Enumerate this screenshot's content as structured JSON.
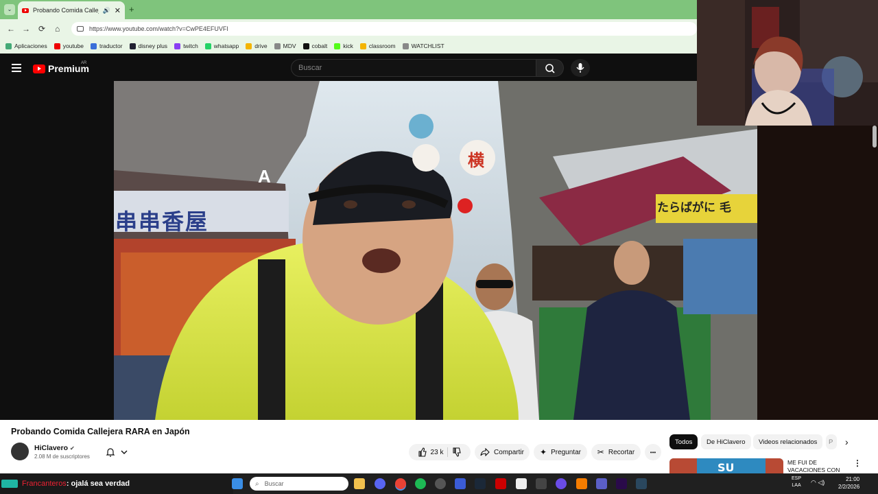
{
  "browser": {
    "tab_title": "Probando Comida Callejera",
    "tab_close": "✕",
    "new_tab": "+",
    "url": "https://www.youtube.com/watch?v=CwPE4EFUVFI",
    "nav": {
      "back": "←",
      "forward": "→",
      "reload": "⟳",
      "home": "⌂"
    },
    "bookmarks": [
      {
        "label": "Aplicaciones",
        "color": "#4a7"
      },
      {
        "label": "youtube",
        "color": "#e00"
      },
      {
        "label": "traductor",
        "color": "#3b6fd9"
      },
      {
        "label": "disney plus",
        "color": "#223"
      },
      {
        "label": "twitch",
        "color": "#8a3ff3"
      },
      {
        "label": "whatsapp",
        "color": "#25d366"
      },
      {
        "label": "drive",
        "color": "#f4b400"
      },
      {
        "label": "MDV",
        "color": "#888"
      },
      {
        "label": "cobalt",
        "color": "#111"
      },
      {
        "label": "kick",
        "color": "#53fc18"
      },
      {
        "label": "classroom",
        "color": "#f4b400"
      },
      {
        "label": "WATCHLIST",
        "color": "#888"
      }
    ]
  },
  "youtube": {
    "logo_text": "Premium",
    "region": "AR",
    "search_placeholder": "Buscar",
    "video_title": "Probando Comida Callejera RARA en Japón",
    "channel_name": "HiClavero",
    "verified": "✔",
    "subscribers": "2.08 M de suscriptores",
    "like_count": "23 k",
    "share_label": "Compartir",
    "ask_label": "Preguntar",
    "clip_label": "Recortar",
    "more_label": "•••",
    "chips": [
      "Todos",
      "De HiClavero",
      "Videos relacionados",
      "P"
    ],
    "rec_title_line1": "ME FUI DE",
    "rec_title_line2": "VACACIONES CON",
    "sign_left": "串串香屋",
    "sign_right": "たらばがに 毛",
    "sign_center": "横",
    "sign_letter": "A"
  },
  "taskbar": {
    "chat_user": "Francanteros",
    "chat_message": ": ojalá sea verdad",
    "search_placeholder": "Buscar",
    "lang_line1": "ESP",
    "lang_line2": "LAA",
    "time": "21:00",
    "date": "2/2/2026"
  }
}
